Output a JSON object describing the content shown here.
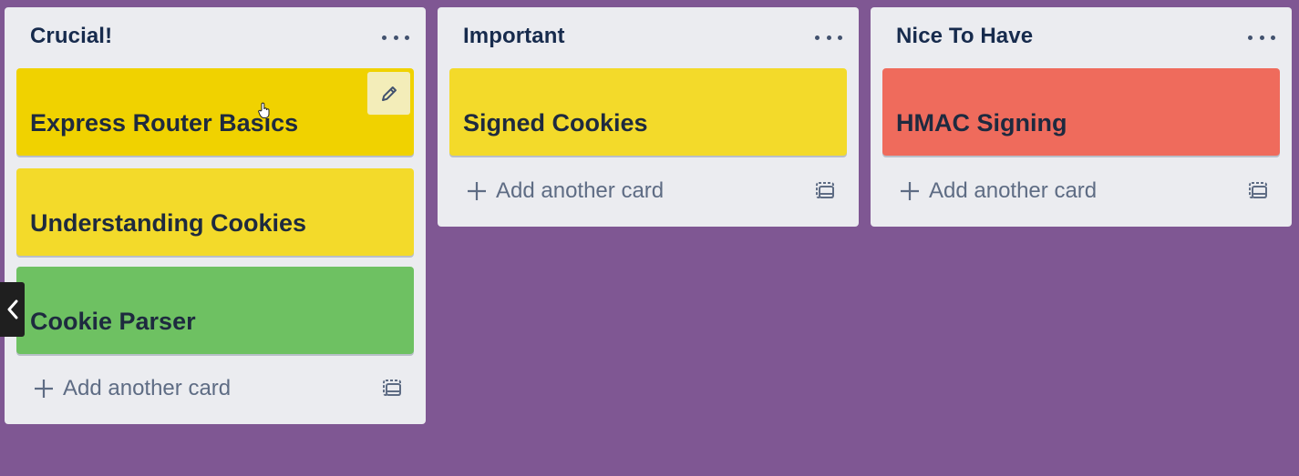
{
  "colors": {
    "board_background": "#7f5793",
    "list_background": "#ebecf0",
    "label_yellow_dark": "#f0d200",
    "label_yellow": "#f3da2a",
    "label_green": "#6ec162",
    "label_red": "#ef6b5c"
  },
  "lists": [
    {
      "title": "Crucial!",
      "menu_icon": "more-horizontal-icon",
      "cards": [
        {
          "title": "Express Router Basics",
          "color": "#f0d200"
        },
        {
          "title": "Understanding Cookies",
          "color": "#f3da2a"
        },
        {
          "title": "Cookie Parser",
          "color": "#6ec162"
        }
      ],
      "add_label": "Add another card",
      "template_icon": "card-template-icon"
    },
    {
      "title": "Important",
      "menu_icon": "more-horizontal-icon",
      "cards": [
        {
          "title": "Signed Cookies",
          "color": "#f3da2a"
        }
      ],
      "add_label": "Add another card",
      "template_icon": "card-template-icon"
    },
    {
      "title": "Nice To Have",
      "menu_icon": "more-horizontal-icon",
      "cards": [
        {
          "title": "HMAC Signing",
          "color": "#ef6b5c"
        }
      ],
      "add_label": "Add another card",
      "template_icon": "card-template-icon"
    }
  ],
  "card_edit_icon": "pencil-icon",
  "side_toggle_icon": "chevron-left-icon"
}
